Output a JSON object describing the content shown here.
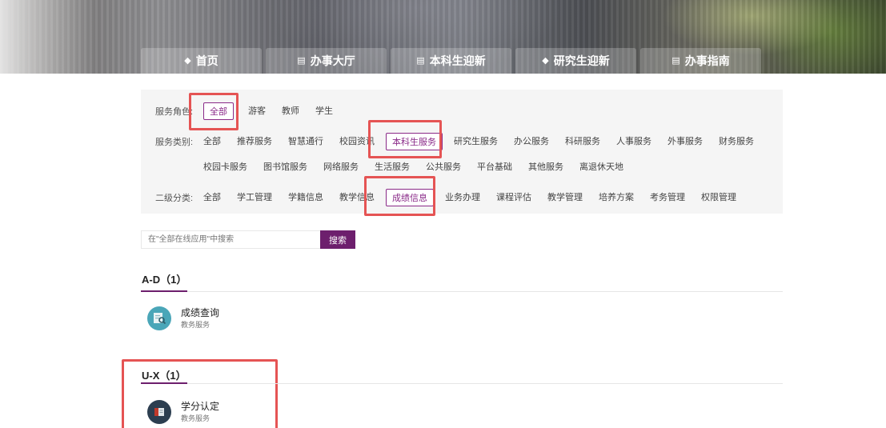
{
  "nav": {
    "tabs": [
      {
        "label": "首页",
        "icon": "cube-icon"
      },
      {
        "label": "办事大厅",
        "icon": "list-icon"
      },
      {
        "label": "本科生迎新",
        "icon": "list-icon"
      },
      {
        "label": "研究生迎新",
        "icon": "cube-icon"
      },
      {
        "label": "办事指南",
        "icon": "building-icon"
      }
    ]
  },
  "filters": {
    "role": {
      "label": "服务角色:",
      "options": [
        "全部",
        "游客",
        "教师",
        "学生"
      ],
      "selected": "全部"
    },
    "category": {
      "label": "服务类别:",
      "options_row1": [
        "全部",
        "推荐服务",
        "智慧通行",
        "校园资讯",
        "本科生服务",
        "研究生服务",
        "办公服务",
        "科研服务",
        "人事服务",
        "外事服务",
        "财务服务"
      ],
      "options_row2": [
        "校园卡服务",
        "图书馆服务",
        "网络服务",
        "生活服务",
        "公共服务",
        "平台基础",
        "其他服务",
        "离退休天地"
      ],
      "selected": "本科生服务"
    },
    "subcategory": {
      "label": "二级分类:",
      "options": [
        "全部",
        "学工管理",
        "学籍信息",
        "教学信息",
        "成绩信息",
        "业务办理",
        "课程评估",
        "教学管理",
        "培养方案",
        "考务管理",
        "权限管理"
      ],
      "selected": "成绩信息"
    }
  },
  "search": {
    "placeholder": "在\"全部在线应用\"中搜索",
    "button_label": "搜索"
  },
  "sections": [
    {
      "title": "A-D（1）",
      "apps": [
        {
          "name": "成绩查询",
          "category": "教务服务",
          "icon": "magnifier-document-icon"
        }
      ]
    },
    {
      "title": "U-X（1）",
      "apps": [
        {
          "name": "学分认定",
          "category": "教务服务",
          "icon": "book-icon"
        }
      ]
    }
  ],
  "colors": {
    "accent": "#6d1f6d",
    "selected_border": "#8a2a88",
    "highlight": "#e55454"
  }
}
